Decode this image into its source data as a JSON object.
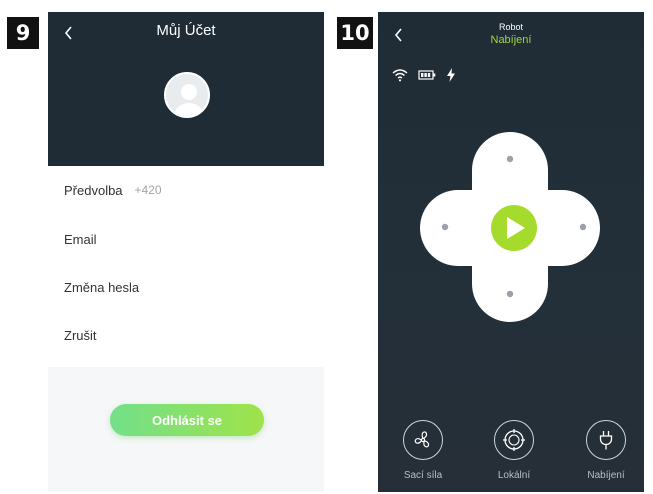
{
  "step_badges": [
    "9",
    "10"
  ],
  "account_screen": {
    "title": "Můj Účet",
    "back_icon": "chevron-left-icon",
    "avatar_icon": "user-avatar-icon",
    "rows": [
      {
        "label": "Předvolba",
        "value": "+420"
      },
      {
        "label": "Email",
        "value": ""
      },
      {
        "label": "Změna hesla",
        "value": ""
      },
      {
        "label": "Zrušit",
        "value": ""
      }
    ],
    "logout_label": "Odhlásit se",
    "colors": {
      "header": "#1f2b35",
      "accent_start": "#72e08a",
      "accent_end": "#9fe24a"
    }
  },
  "robot_screen": {
    "title": "Robot",
    "status": "Nabíjení",
    "status_icons": [
      "wifi-icon",
      "battery-icon",
      "charging-bolt-icon"
    ],
    "control_icon": "play-icon",
    "modes": [
      {
        "label": "Sací síla",
        "icon": "fan-icon"
      },
      {
        "label": "Lokální",
        "icon": "spot-clean-icon"
      },
      {
        "label": "Nabíjení",
        "icon": "plug-icon"
      }
    ],
    "colors": {
      "background": "#1f2b35",
      "accent": "#9fd83a",
      "play": "#a5db2c"
    }
  }
}
